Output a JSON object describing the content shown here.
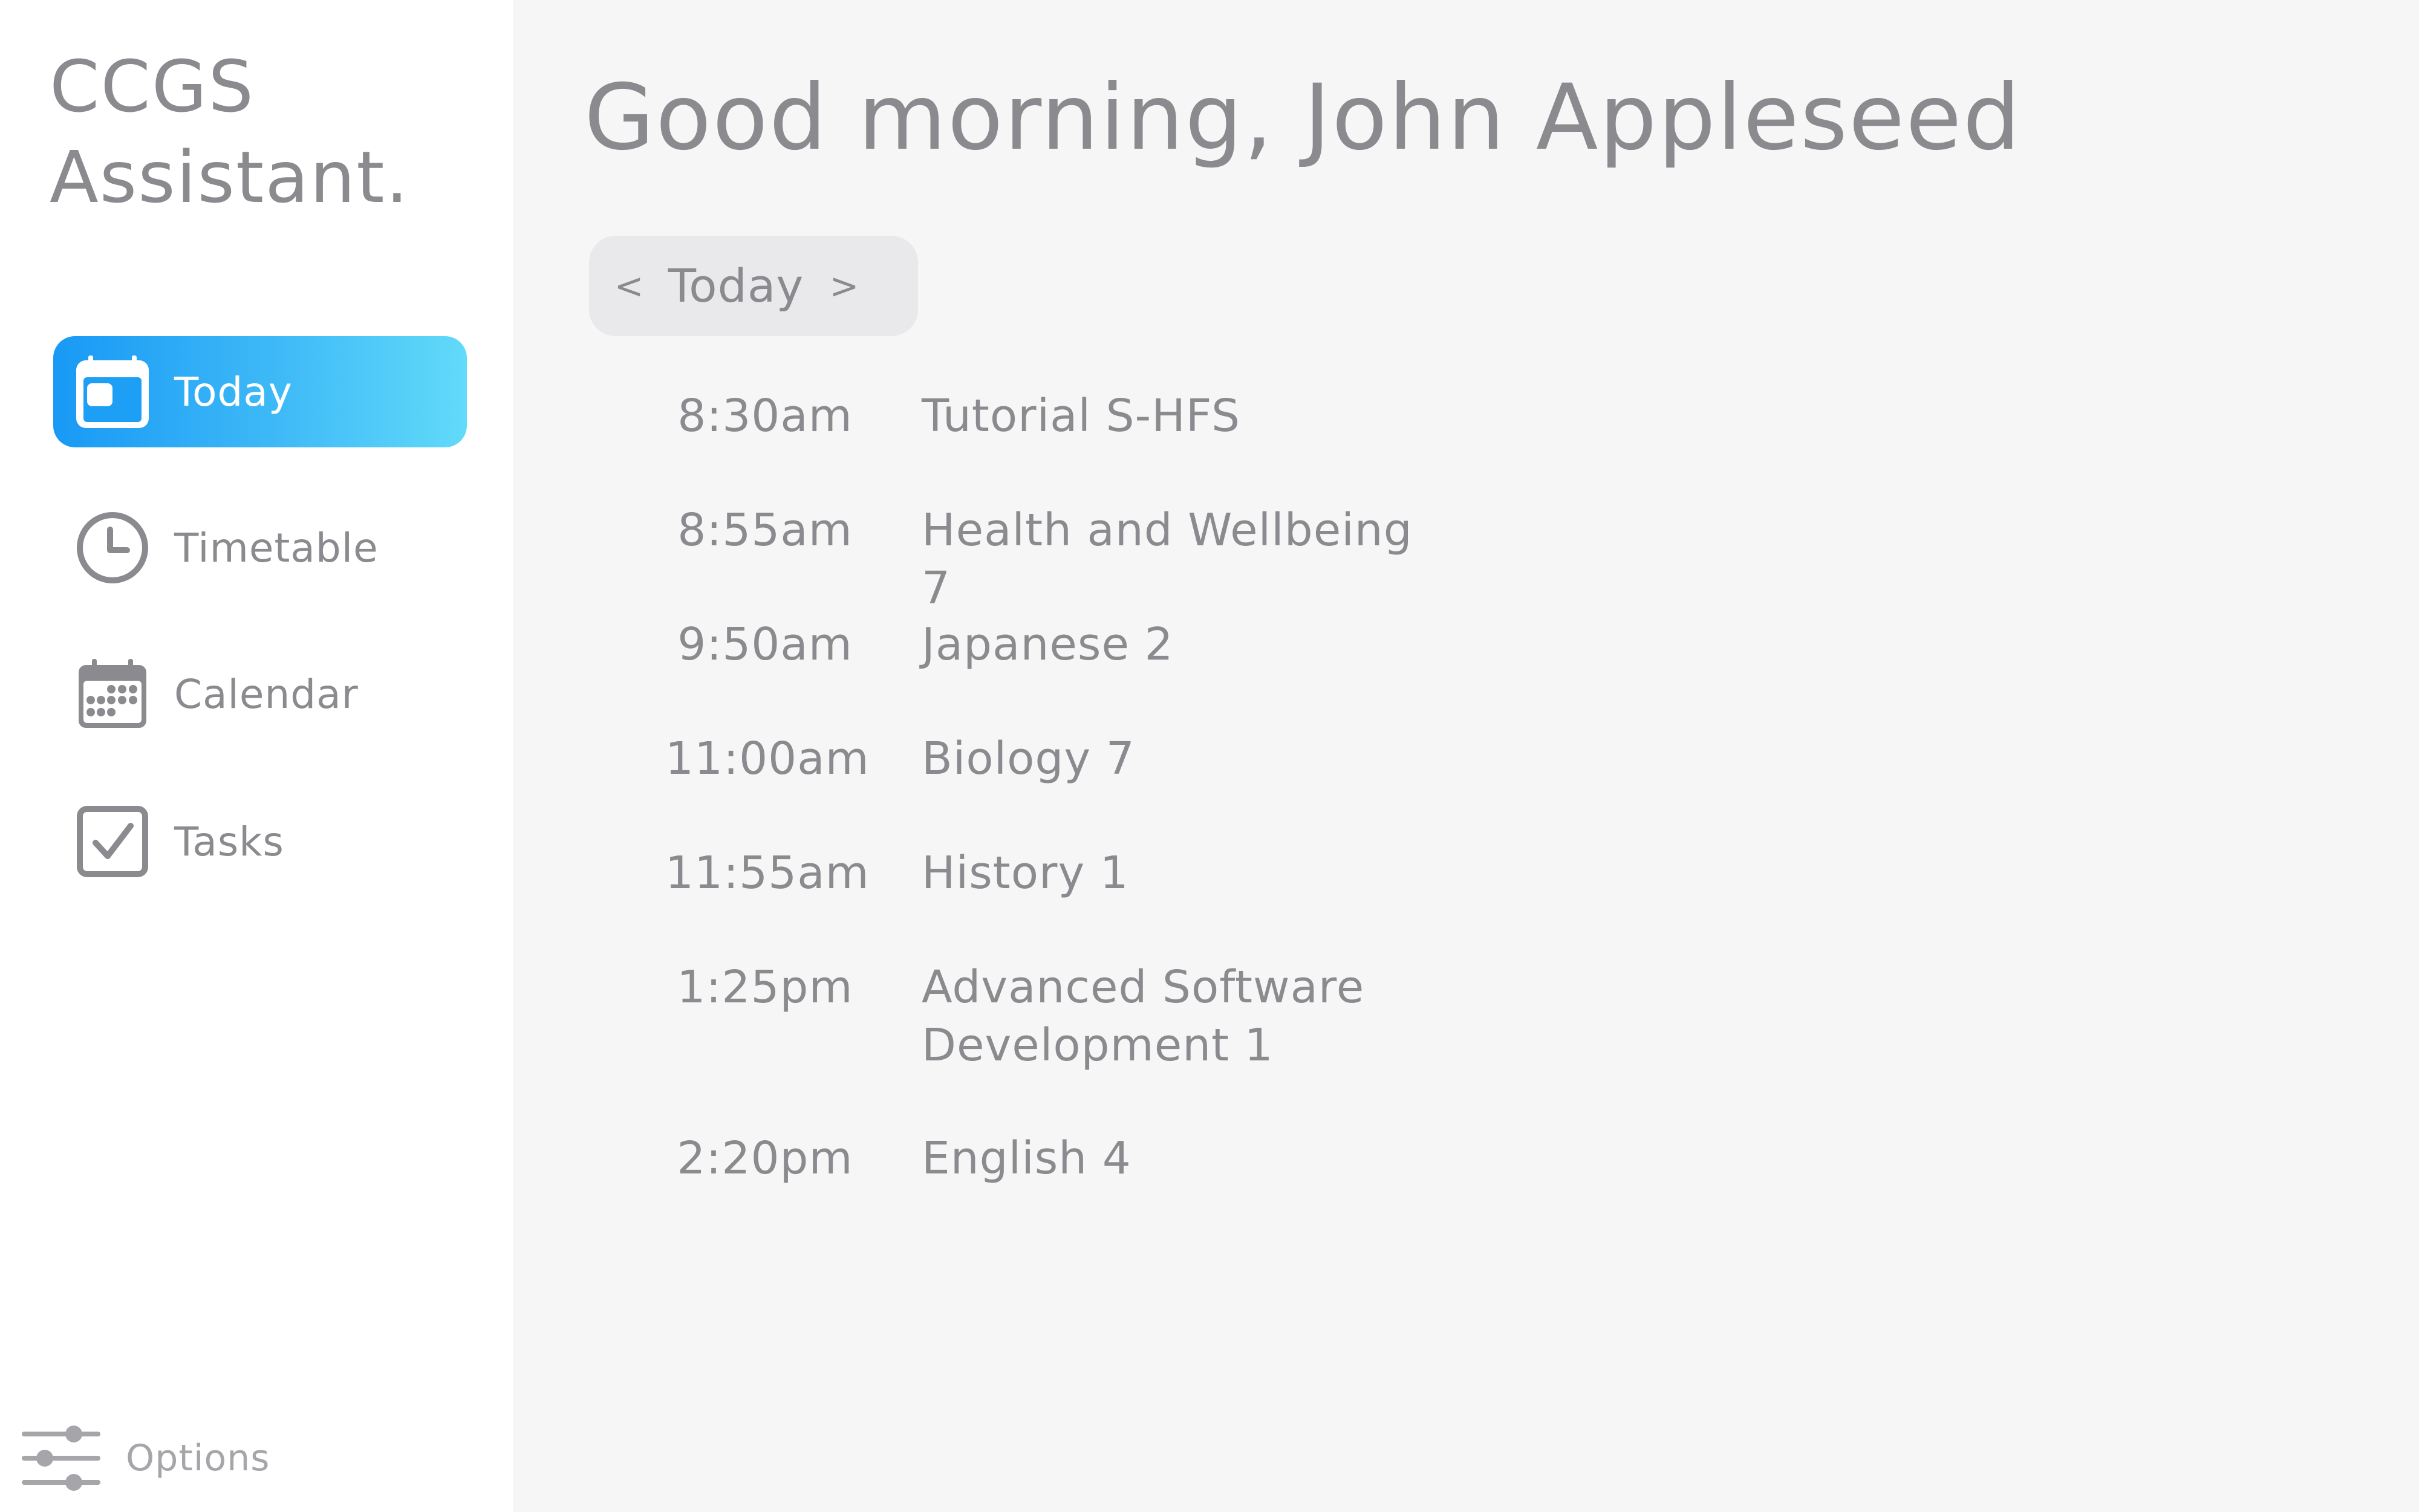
{
  "app": {
    "title": "CCGS Assistant."
  },
  "sidebar": {
    "items": [
      {
        "label": "Today",
        "icon": "calendar-day-icon",
        "active": true
      },
      {
        "label": "Timetable",
        "icon": "clock-icon",
        "active": false
      },
      {
        "label": "Calendar",
        "icon": "calendar-grid-icon",
        "active": false
      },
      {
        "label": "Tasks",
        "icon": "checkbox-icon",
        "active": false
      }
    ],
    "options": {
      "label": "Options",
      "icon": "sliders-icon"
    }
  },
  "main": {
    "greeting": "Good morning, John Appleseed",
    "day_switcher": {
      "prev": "<",
      "label": "Today",
      "next": ">"
    },
    "schedule": [
      {
        "time": "8:30am",
        "subject": "Tutorial S-HFS"
      },
      {
        "time": "8:55am",
        "subject": "Health and Wellbeing 7"
      },
      {
        "time": "9:50am",
        "subject": "Japanese 2"
      },
      {
        "time": "11:00am",
        "subject": "Biology 7"
      },
      {
        "time": "11:55am",
        "subject": "History 1"
      },
      {
        "time": "1:25pm",
        "subject": "Advanced Software Development 1"
      },
      {
        "time": "2:20pm",
        "subject": "English 4"
      }
    ]
  },
  "colors": {
    "text": "#8b8b8f",
    "muted": "#a6a6aa",
    "accent_start": "#1899f5",
    "accent_end": "#62daf9",
    "sidebar_bg": "#ffffff",
    "main_bg": "#f6f6f6",
    "pill_bg": "#e9e9eb"
  }
}
